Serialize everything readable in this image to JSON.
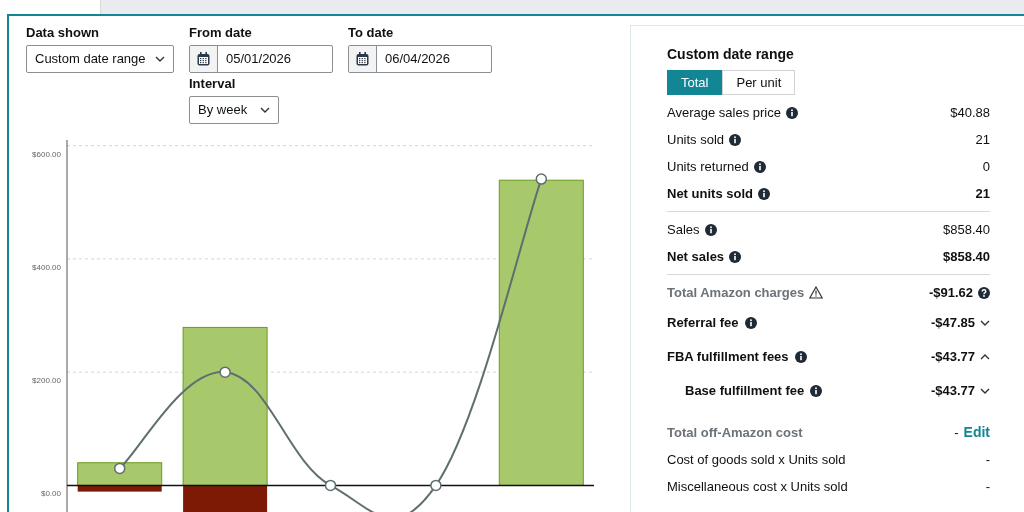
{
  "filters": {
    "data_shown": {
      "label": "Data shown",
      "value": "Custom date range"
    },
    "from_date": {
      "label": "From date",
      "value": "05/01/2026"
    },
    "to_date": {
      "label": "To date",
      "value": "06/04/2026"
    },
    "interval": {
      "label": "Interval",
      "value": "By week"
    }
  },
  "chart_data": {
    "type": "bar",
    "stacked": true,
    "grid": true,
    "ylim": [
      -47,
      610
    ],
    "yticks": [
      {
        "value": 0,
        "label": "$0.00"
      },
      {
        "value": 200,
        "label": "$200.00"
      },
      {
        "value": 400,
        "label": "$400.00"
      },
      {
        "value": 600,
        "label": "$600.00"
      }
    ],
    "series": [
      {
        "color": "#a8c86c",
        "values": [
          40,
          279,
          0,
          0,
          539
        ]
      },
      {
        "color": "#7c1a05",
        "values": [
          -11,
          -47,
          0,
          0,
          0
        ]
      },
      {
        "type": "line",
        "marker": "circle",
        "color": "#5f6f6f",
        "values": [
          30,
          200,
          0,
          0,
          541
        ]
      }
    ]
  },
  "summary": {
    "title": "Custom date range",
    "toggle": [
      {
        "label": "Total",
        "selected": true
      },
      {
        "label": "Per unit",
        "selected": false
      }
    ],
    "groups": [
      [
        {
          "kind": "stat",
          "label": "Average sales price",
          "value": "$40.88"
        },
        {
          "kind": "stat",
          "label": "Units sold",
          "value": "21"
        },
        {
          "kind": "stat",
          "label": "Units returned",
          "value": "0"
        },
        {
          "kind": "total",
          "label": "Net units sold",
          "value": "21"
        }
      ],
      [
        {
          "kind": "stat",
          "label": "Sales",
          "value": "$858.40"
        },
        {
          "kind": "total",
          "label": "Net sales",
          "value": "$858.40"
        }
      ],
      [
        {
          "kind": "charges",
          "label": "Total Amazon charges",
          "value": "-$91.62"
        },
        {
          "kind": "fee",
          "label": "Referral fee",
          "value": "-$47.85",
          "expanded": false
        },
        {
          "kind": "fee",
          "label": "FBA fulfillment fees",
          "value": "-$43.77",
          "expanded": true,
          "children": [
            {
              "kind": "fee",
              "label": "Base fulfillment fee",
              "value": "-$43.77",
              "expanded": false
            }
          ]
        },
        {
          "kind": "cost",
          "label": "Total off-Amazon cost",
          "value": "-",
          "link": "Edit"
        },
        {
          "kind": "plain",
          "label": "Cost of goods sold x Units sold",
          "value": "-"
        },
        {
          "kind": "plain",
          "label": "Miscellaneous cost x Units sold",
          "value": "-"
        }
      ]
    ]
  }
}
